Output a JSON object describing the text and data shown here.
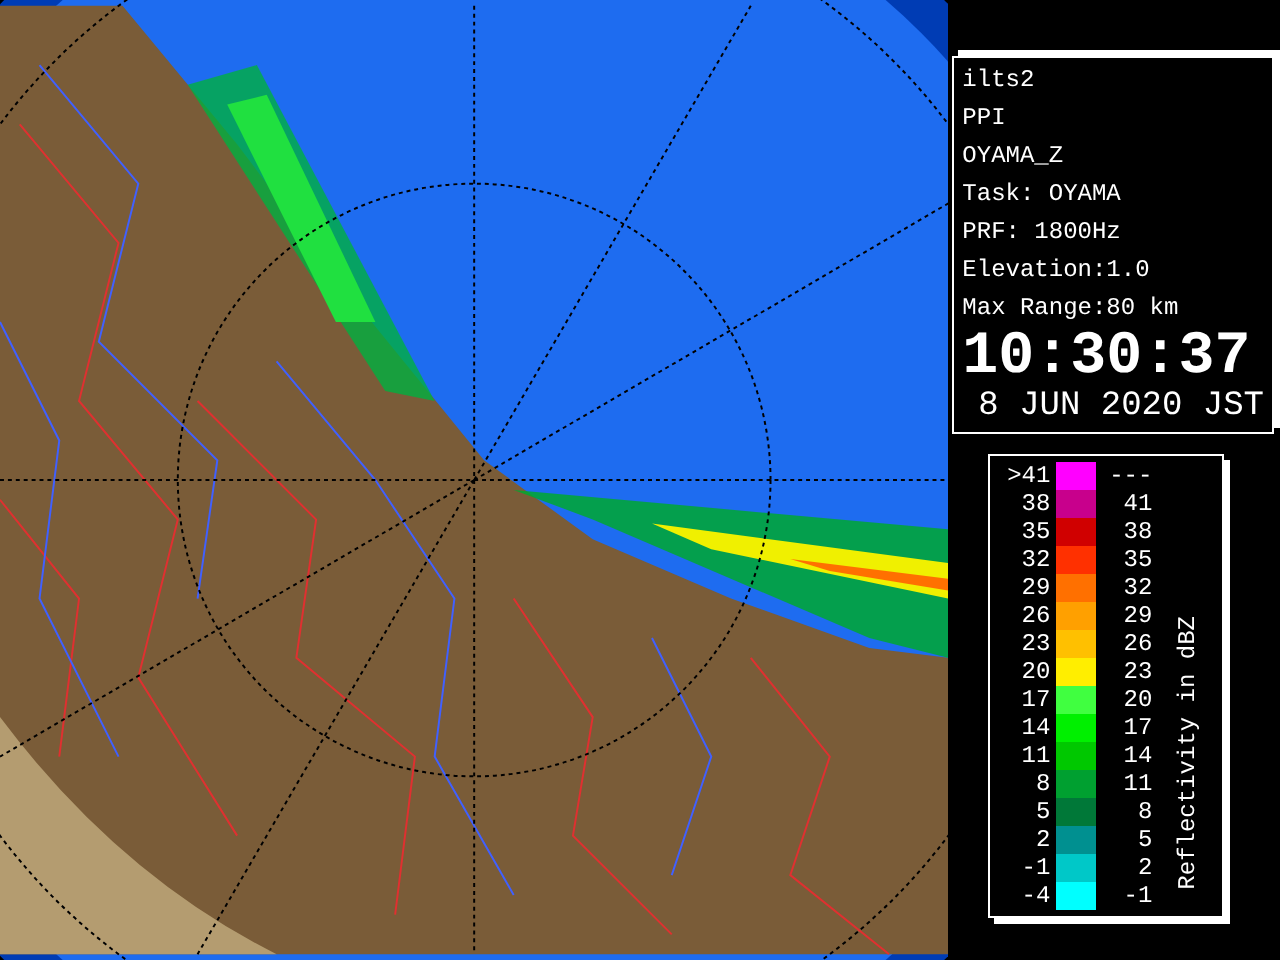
{
  "info": {
    "lines": [
      "ilts2",
      "PPI",
      "OYAMA_Z",
      "Task: OYAMA",
      "PRF: 1800Hz",
      "Elevation:1.0",
      "Max Range:80 km"
    ],
    "time": "10:30:37",
    "date": "8 JUN 2020 JST"
  },
  "legend": {
    "title": "Reflectivity in dBZ",
    "rows": [
      {
        "low": ">41",
        "high": "---",
        "color": "#ff00ff"
      },
      {
        "low": "38",
        "high": "41",
        "color": "#c8008c"
      },
      {
        "low": "35",
        "high": "38",
        "color": "#d00000"
      },
      {
        "low": "32",
        "high": "35",
        "color": "#ff3000"
      },
      {
        "low": "29",
        "high": "32",
        "color": "#ff7000"
      },
      {
        "low": "26",
        "high": "29",
        "color": "#ffa000"
      },
      {
        "low": "23",
        "high": "26",
        "color": "#ffc000"
      },
      {
        "low": "20",
        "high": "23",
        "color": "#ffee00"
      },
      {
        "low": "17",
        "high": "20",
        "color": "#40ff40"
      },
      {
        "low": "14",
        "high": "17",
        "color": "#00f000"
      },
      {
        "low": "11",
        "high": "14",
        "color": "#00c800"
      },
      {
        "low": "8",
        "high": "11",
        "color": "#00a030"
      },
      {
        "low": "5",
        "high": "8",
        "color": "#007838"
      },
      {
        "low": "2",
        "high": "5",
        "color": "#009090"
      },
      {
        "low": "-1",
        "high": "2",
        "color": "#00c8c8"
      },
      {
        "low": "-4",
        "high": "-1",
        "color": "#00ffff"
      }
    ]
  }
}
